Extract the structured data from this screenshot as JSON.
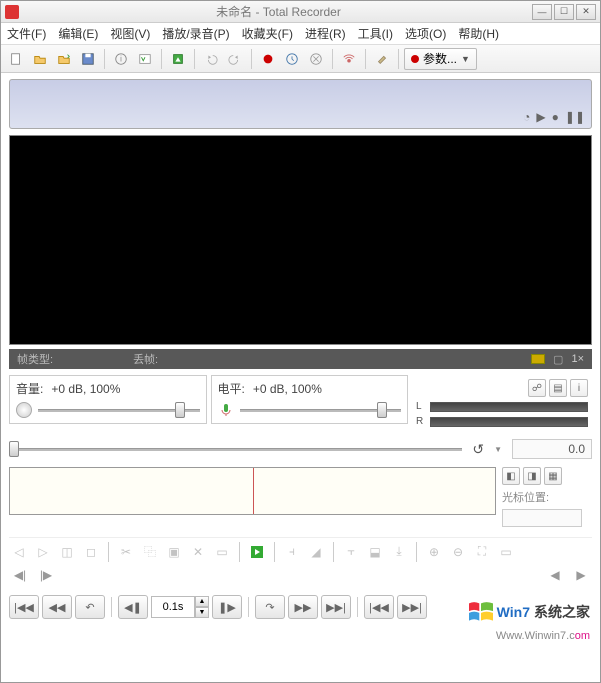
{
  "title": "未命名 - Total Recorder",
  "menus": [
    "文件(F)",
    "编辑(E)",
    "视图(V)",
    "播放/录音(P)",
    "收藏夹(F)",
    "进程(R)",
    "工具(I)",
    "选项(O)",
    "帮助(H)"
  ],
  "toolbar": {
    "params_label": "参数..."
  },
  "status": {
    "frame_type_label": "帧类型:",
    "drop_label": "丢帧:",
    "zoom": "1×"
  },
  "volume": {
    "label": "音量:",
    "value": "+0 dB, 100%"
  },
  "level": {
    "label": "电平:",
    "value": "+0 dB, 100%"
  },
  "meters": {
    "left": "L",
    "right": "R"
  },
  "position": {
    "time": "0.0"
  },
  "wave": {
    "cursor_label": "光标位置:"
  },
  "transport": {
    "step": "0.1s"
  },
  "watermark": {
    "brand_a": "Win7",
    "brand_b": "系统之家",
    "url_a": "Www.Winwin7.c",
    "url_b": "om"
  }
}
